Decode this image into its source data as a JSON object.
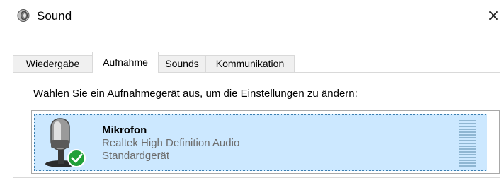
{
  "window": {
    "title": "Sound",
    "close_glyph": "×",
    "icon": "speaker-icon"
  },
  "tabs": [
    {
      "label": "Wiedergabe",
      "active": false
    },
    {
      "label": "Aufnahme",
      "active": true
    },
    {
      "label": "Sounds",
      "active": false
    },
    {
      "label": "Kommunikation",
      "active": false
    }
  ],
  "panel": {
    "instruction": "Wählen Sie ein Aufnahmegerät aus, um die Einstellungen zu ändern:"
  },
  "devices": [
    {
      "name": "Mikrofon",
      "driver": "Realtek High Definition Audio",
      "status": "Standardgerät",
      "icon": "microphone-icon",
      "badge": "default-check-icon",
      "selected": true,
      "level": 0
    }
  ],
  "colors": {
    "selection": "#cce8ff",
    "check": "#21a038",
    "meter": "#8fb6d2"
  }
}
